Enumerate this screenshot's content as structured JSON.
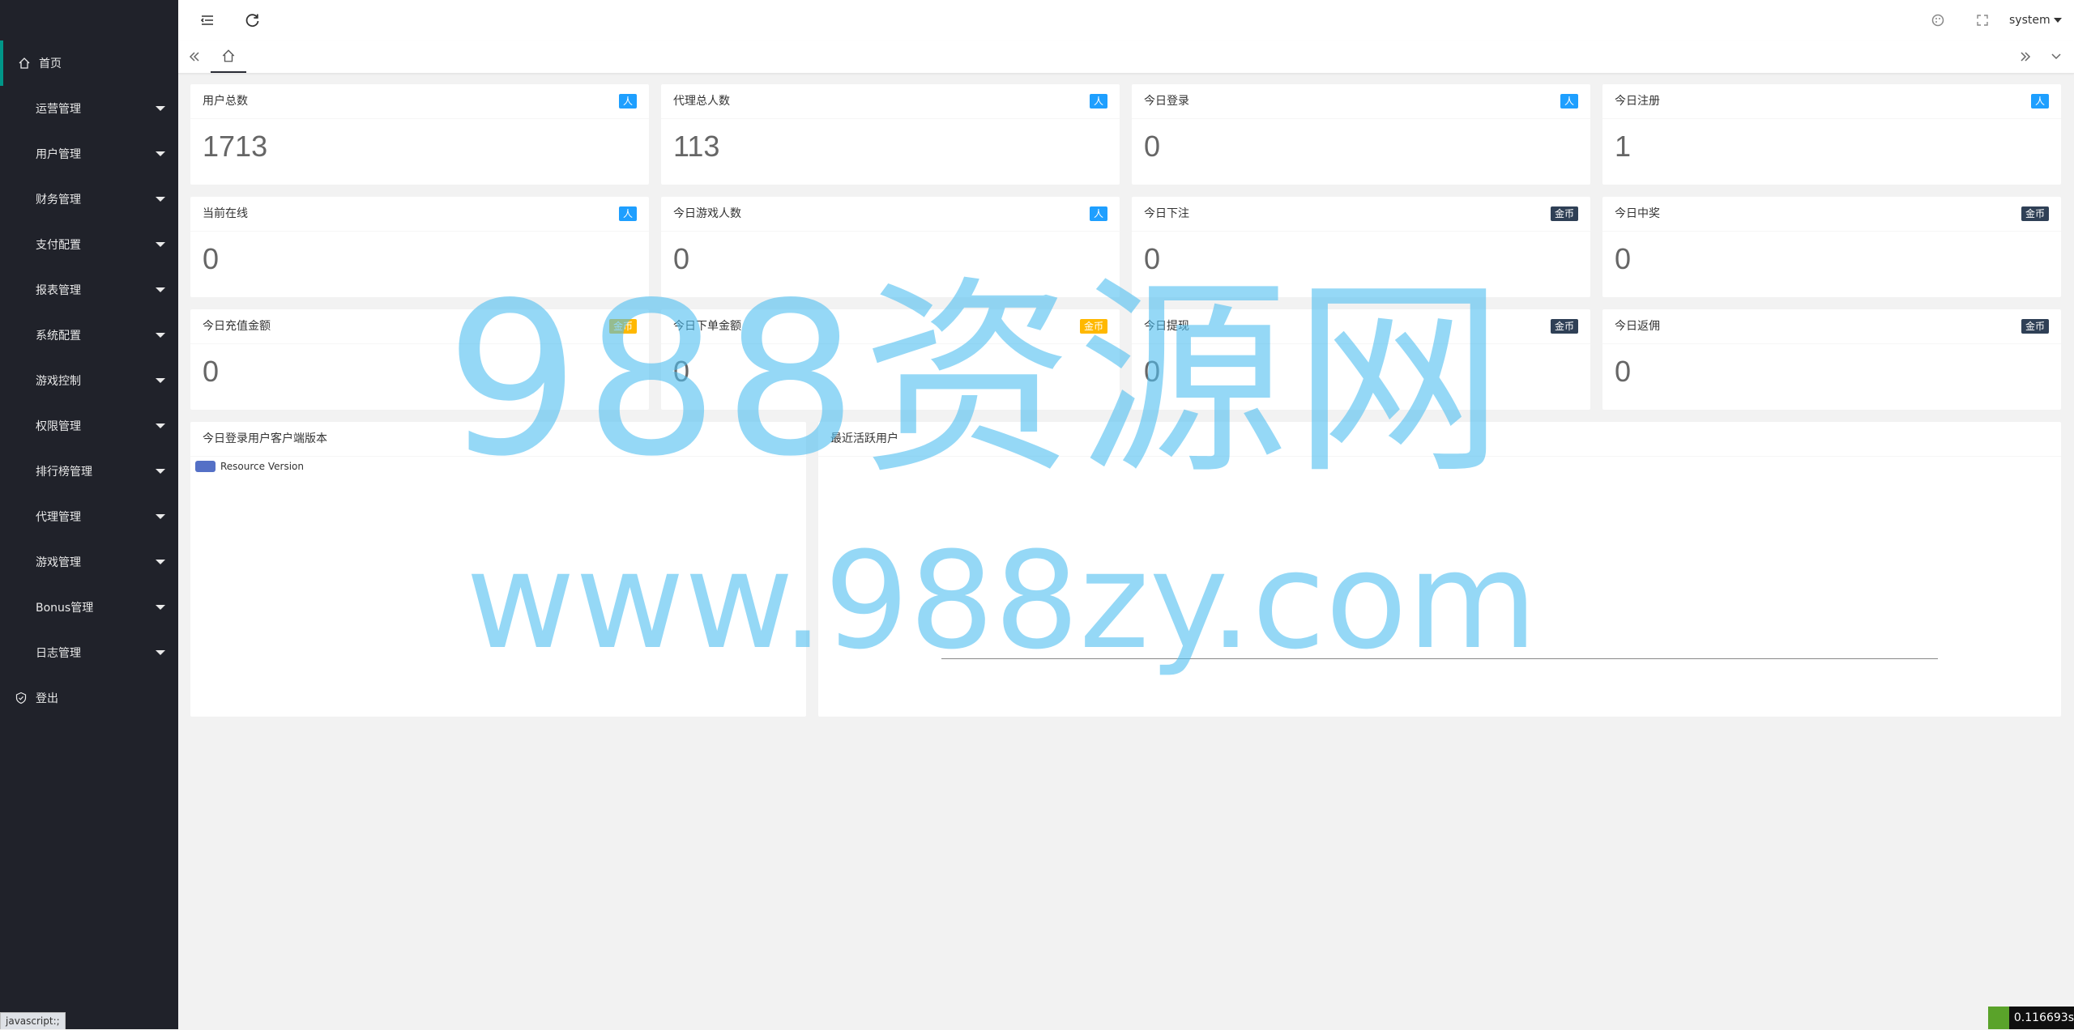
{
  "sidebar": {
    "items": [
      {
        "label": "首页",
        "icon": "home-icon",
        "active": true
      },
      {
        "label": "运营管理"
      },
      {
        "label": "用户管理"
      },
      {
        "label": "财务管理"
      },
      {
        "label": "支付配置"
      },
      {
        "label": "报表管理"
      },
      {
        "label": "系统配置"
      },
      {
        "label": "游戏控制"
      },
      {
        "label": "权限管理"
      },
      {
        "label": "排行榜管理"
      },
      {
        "label": "代理管理"
      },
      {
        "label": "游戏管理"
      },
      {
        "label": "Bonus管理"
      },
      {
        "label": "日志管理"
      },
      {
        "label": "登出",
        "icon": "shield-icon"
      }
    ]
  },
  "header": {
    "user": "system"
  },
  "cards": [
    {
      "title": "用户总数",
      "badge": "人",
      "badge_color": "#1e9fff",
      "value": "1713"
    },
    {
      "title": "代理总人数",
      "badge": "人",
      "badge_color": "#1e9fff",
      "value": "113"
    },
    {
      "title": "今日登录",
      "badge": "人",
      "badge_color": "#1e9fff",
      "value": "0"
    },
    {
      "title": "今日注册",
      "badge": "人",
      "badge_color": "#1e9fff",
      "value": "1"
    },
    {
      "title": "当前在线",
      "badge": "人",
      "badge_color": "#1e9fff",
      "value": "0"
    },
    {
      "title": "今日游戏人数",
      "badge": "人",
      "badge_color": "#1e9fff",
      "value": "0"
    },
    {
      "title": "今日下注",
      "badge": "金币",
      "badge_color": "#2f4056",
      "value": "0"
    },
    {
      "title": "今日中奖",
      "badge": "金币",
      "badge_color": "#2f4056",
      "value": "0"
    },
    {
      "title": "今日充值金额",
      "badge": "金币",
      "badge_color": "#ffb800",
      "value": "0"
    },
    {
      "title": "今日下单金额",
      "badge": "金币",
      "badge_color": "#ffb800",
      "value": "0"
    },
    {
      "title": "今日提现",
      "badge": "金币",
      "badge_color": "#2f4056",
      "value": "0"
    },
    {
      "title": "今日返佣",
      "badge": "金币",
      "badge_color": "#2f4056",
      "value": "0"
    }
  ],
  "panels": {
    "client_version": {
      "title": "今日登录用户客户端版本",
      "legend": "Resource Version",
      "legend_color": "#5470c6"
    },
    "active_users": {
      "title": "最近活跃用户"
    }
  },
  "watermark": {
    "line1": "988资源网",
    "line2": "www.988zy.com"
  },
  "status_bar": {
    "link": "javascript:;",
    "timer": "0.116693s"
  }
}
